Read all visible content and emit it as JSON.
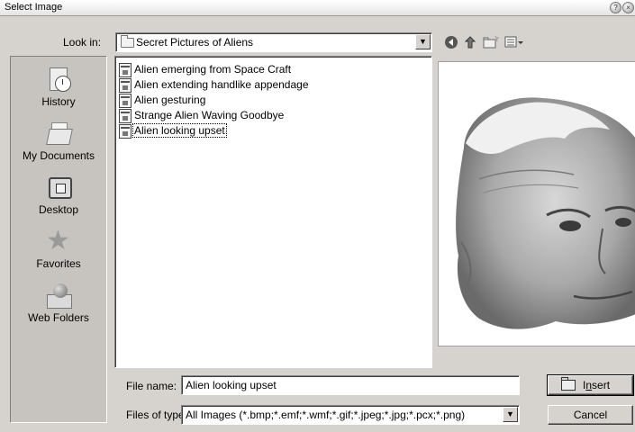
{
  "window": {
    "title": "Select Image"
  },
  "look_in": {
    "label": "Look in:",
    "value": "Secret Pictures of Aliens",
    "icon": "folder-icon"
  },
  "toolbar": {
    "icons": [
      "back-icon",
      "up-folder-icon",
      "new-folder-icon",
      "views-menu-icon"
    ]
  },
  "places": [
    {
      "label": "History",
      "icon": "history-icon"
    },
    {
      "label": "My Documents",
      "icon": "my-documents-icon"
    },
    {
      "label": "Desktop",
      "icon": "desktop-icon"
    },
    {
      "label": "Favorites",
      "icon": "favorites-icon"
    },
    {
      "label": "Web Folders",
      "icon": "web-folders-icon"
    }
  ],
  "files": [
    {
      "name": "Alien emerging from Space Craft"
    },
    {
      "name": "Alien extending handlike appendage"
    },
    {
      "name": "Alien gesturing"
    },
    {
      "name": "Strange Alien Waving Goodbye"
    },
    {
      "name": "Alien looking upset"
    }
  ],
  "selected_file": "Alien looking upset",
  "file_name": {
    "label": "File name:",
    "value": "Alien looking upset"
  },
  "file_type": {
    "label": "Files of type:",
    "value": "All Images (*.bmp;*.emf;*.wmf;*.gif;*.jpeg;*.jpg;*.pcx;*.png)"
  },
  "buttons": {
    "insert_prefix": "I",
    "insert_underline": "n",
    "insert_suffix": "sert",
    "cancel": "Cancel"
  }
}
